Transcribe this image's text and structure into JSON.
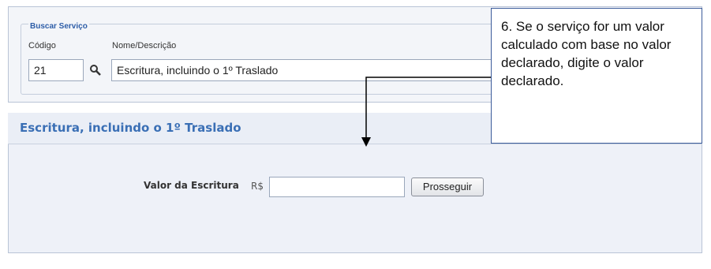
{
  "search": {
    "legend": "Buscar Serviço",
    "code_label": "Código",
    "name_label": "Nome/Descrição",
    "code_value": "21",
    "name_value": "Escritura, incluindo o 1º Traslado"
  },
  "result": {
    "title": "Escritura, incluindo o 1º Traslado",
    "valor_label": "Valor da Escritura",
    "currency": "R$",
    "valor_value": "",
    "proceed_label": "Prosseguir"
  },
  "callout": {
    "text": "6. Se o serviço for um valor calculado com base no valor declarado, digite o valor declarado."
  }
}
